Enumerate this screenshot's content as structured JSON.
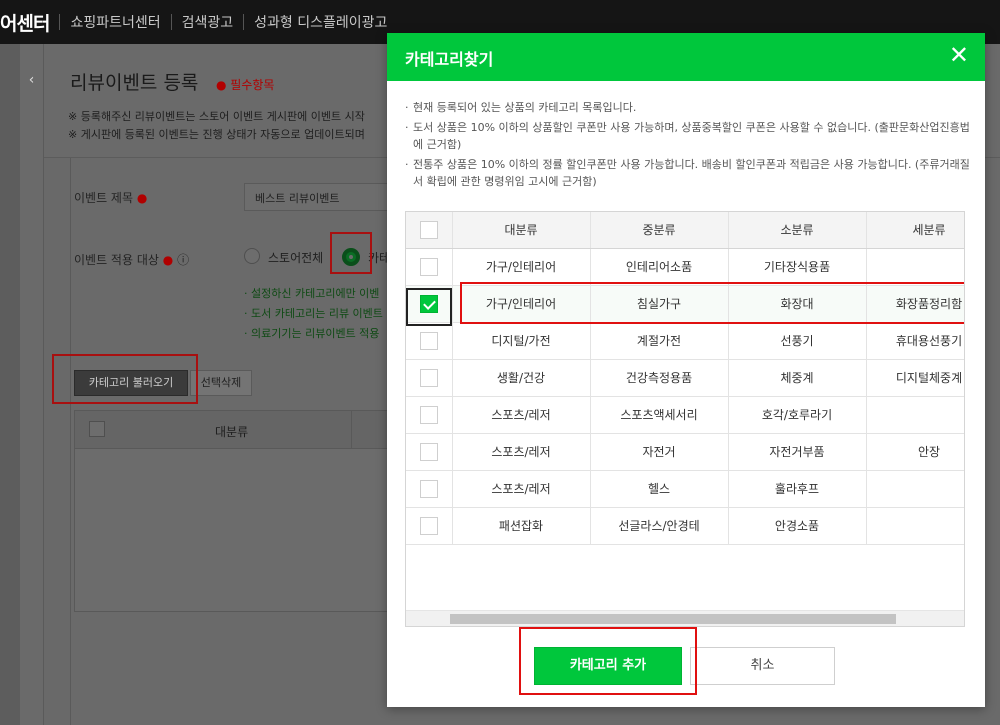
{
  "topnav": {
    "brand": "어센터",
    "links": [
      "쇼핑파트너센터",
      "검색광고",
      "성과형 디스플레이광고"
    ]
  },
  "page": {
    "back_icon": "‹",
    "title": "리뷰이벤트 등록",
    "required_mark": "● 필수항목",
    "notice1": "※ 등록해주신 리뷰이벤트는 스토어 이벤트 게시판에 이벤트 시작",
    "notice2": "※ 게시판에 등록된 이벤트는 진행 상태가 자동으로 업데이트되며",
    "form": {
      "title_label": "이벤트 제목",
      "title_value": "베스트 리뷰이벤트",
      "target_label": "이벤트 적용 대상",
      "info_icon": "ⓘ",
      "option_all": "스토어전체",
      "option_cat": "카테",
      "notes": [
        "· 설정하신 카테고리에만 이벤",
        "· 도서 카테고리는 리뷰 이벤트",
        "· 의료기기는 리뷰이벤트 적용"
      ],
      "load_button": "카테고리 불러오기",
      "delete_button": "선택삭제",
      "table_header": "대분류"
    }
  },
  "modal": {
    "title": "카테고리찾기",
    "close_icon": "✕",
    "notes": [
      "현재 등록되어 있는 상품의 카테고리 목록입니다.",
      "도서 상품은 10% 이하의 상품할인 쿠폰만 사용 가능하며, 상품중복할인 쿠폰은 사용할 수 없습니다. (출판문화산업진흥법에 근거함)",
      "전통주 상품은 10% 이하의 정률 할인쿠폰만 사용 가능합니다. 배송비 할인쿠폰과 적립금은 사용 가능합니다. (주류거래질서 확립에 관한 명령위임 고시에 근거함)"
    ],
    "columns": [
      "대분류",
      "중분류",
      "소분류",
      "세분류"
    ],
    "rows": [
      {
        "checked": false,
        "c1": "가구/인테리어",
        "c2": "인테리어소품",
        "c3": "기타장식용품",
        "c4": ""
      },
      {
        "checked": true,
        "c1": "가구/인테리어",
        "c2": "침실가구",
        "c3": "화장대",
        "c4": "화장품정리함"
      },
      {
        "checked": false,
        "c1": "디지털/가전",
        "c2": "계절가전",
        "c3": "선풍기",
        "c4": "휴대용선풍기"
      },
      {
        "checked": false,
        "c1": "생활/건강",
        "c2": "건강측정용품",
        "c3": "체중계",
        "c4": "디지털체중계"
      },
      {
        "checked": false,
        "c1": "스포츠/레저",
        "c2": "스포츠액세서리",
        "c3": "호각/호루라기",
        "c4": ""
      },
      {
        "checked": false,
        "c1": "스포츠/레저",
        "c2": "자전거",
        "c3": "자전거부품",
        "c4": "안장"
      },
      {
        "checked": false,
        "c1": "스포츠/레저",
        "c2": "헬스",
        "c3": "훌라후프",
        "c4": ""
      },
      {
        "checked": false,
        "c1": "패션잡화",
        "c2": "선글라스/안경테",
        "c3": "안경소품",
        "c4": ""
      }
    ],
    "add_button": "카테고리 추가",
    "cancel_button": "취소"
  },
  "colors": {
    "accent_green": "#00c73c",
    "highlight_red": "#e01010"
  }
}
